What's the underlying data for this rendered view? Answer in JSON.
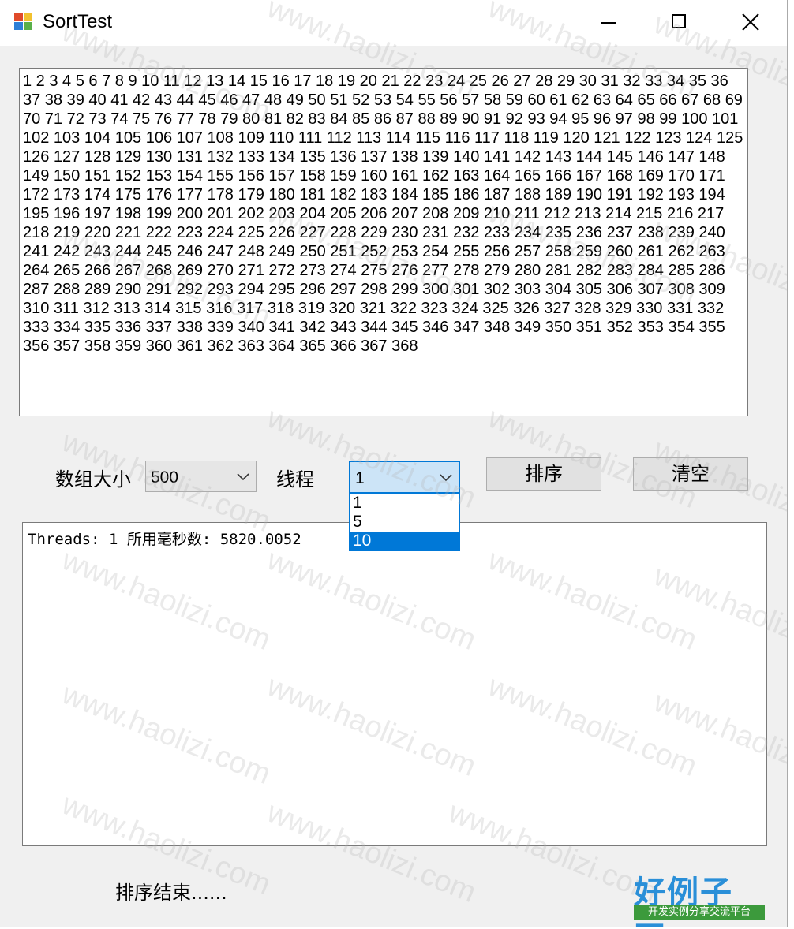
{
  "window": {
    "title": "SortTest"
  },
  "numbers_text": "1 2 3 4 5 6 7 8 9 10 11 12 13 14 15 16 17 18 19 20 21 22 23 24 25 26 27 28 29 30 31 32 33 34 35 36 37 38 39 40 41 42 43 44 45 46 47 48 49 50 51 52 53 54 55 56 57 58 59 60 61 62 63 64 65 66 67 68 69 70 71 72 73 74 75 76 77 78 79 80 81 82 83 84 85 86 87 88 89 90 91 92 93 94 95 96 97 98 99 100 101 102 103 104 105 106 107 108 109 110 111 112 113 114 115 116 117 118 119 120 121 122 123 124 125 126 127 128 129 130 131 132 133 134 135 136 137 138 139 140 141 142 143 144 145 146 147 148 149 150 151 152 153 154 155 156 157 158 159 160 161 162 163 164 165 166 167 168 169 170 171 172 173 174 175 176 177 178 179 180 181 182 183 184 185 186 187 188 189 190 191 192 193 194 195 196 197 198 199 200 201 202 203 204 205 206 207 208 209 210 211 212 213 214 215 216 217 218 219 220 221 222 223 224 225 226 227 228 229 230 231 232 233 234 235 236 237 238 239 240 241 242 243 244 245 246 247 248 249 250 251 252 253 254 255 256 257 258 259 260 261 262 263 264 265 266 267 268 269 270 271 272 273 274 275 276 277 278 279 280 281 282 283 284 285 286 287 288 289 290 291 292 293 294 295 296 297 298 299 300 301 302 303 304 305 306 307 308 309 310 311 312 313 314 315 316 317 318 319 320 321 322 323 324 325 326 327 328 329 330 331 332 333 334 335 336 337 338 339 340 341 342 343 344 345 346 347 348 349 350 351 352 353 354 355 356 357 358 359 360 361 362 363 364 365 366 367 368",
  "controls": {
    "array_size_label": "数组大小",
    "array_size_value": "500",
    "threads_label": "线程",
    "threads_value": "1",
    "threads_options": [
      "1",
      "5",
      "10"
    ],
    "threads_highlighted": "10",
    "sort_button": "排序",
    "clear_button": "清空"
  },
  "log_text": "Threads: 1 所用毫秒数: 5820.0052",
  "status_text": "排序结束......",
  "watermark_text": "www.haolizi.com",
  "logo": {
    "main": "好例子网",
    "sub": "开发实例分享交流平台"
  },
  "colors": {
    "accent": "#0078d7",
    "window_bg": "#f0f0f0",
    "button_bg": "#e1e1e1"
  }
}
